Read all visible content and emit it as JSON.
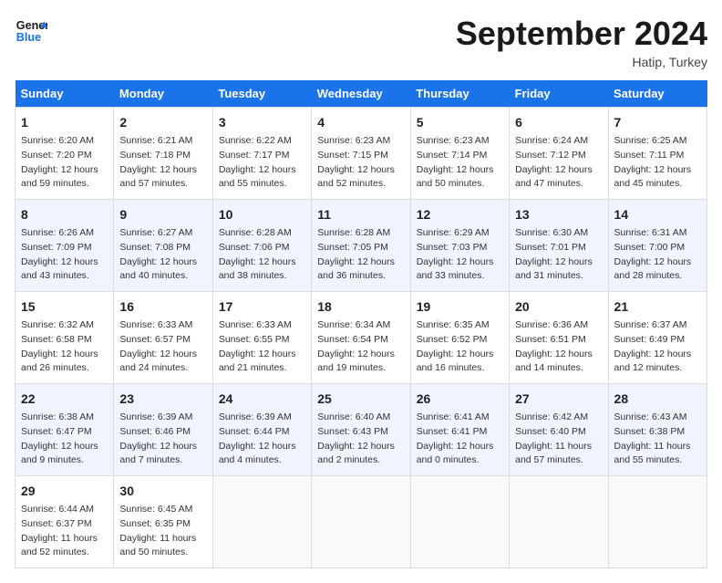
{
  "logo": {
    "line1": "General",
    "line2": "Blue"
  },
  "title": "September 2024",
  "location": "Hatip, Turkey",
  "days_of_week": [
    "Sunday",
    "Monday",
    "Tuesday",
    "Wednesday",
    "Thursday",
    "Friday",
    "Saturday"
  ],
  "weeks": [
    [
      {
        "day": "1",
        "sunrise": "6:20 AM",
        "sunset": "7:20 PM",
        "daylight": "12 hours and 59 minutes."
      },
      {
        "day": "2",
        "sunrise": "6:21 AM",
        "sunset": "7:18 PM",
        "daylight": "12 hours and 57 minutes."
      },
      {
        "day": "3",
        "sunrise": "6:22 AM",
        "sunset": "7:17 PM",
        "daylight": "12 hours and 55 minutes."
      },
      {
        "day": "4",
        "sunrise": "6:23 AM",
        "sunset": "7:15 PM",
        "daylight": "12 hours and 52 minutes."
      },
      {
        "day": "5",
        "sunrise": "6:23 AM",
        "sunset": "7:14 PM",
        "daylight": "12 hours and 50 minutes."
      },
      {
        "day": "6",
        "sunrise": "6:24 AM",
        "sunset": "7:12 PM",
        "daylight": "12 hours and 47 minutes."
      },
      {
        "day": "7",
        "sunrise": "6:25 AM",
        "sunset": "7:11 PM",
        "daylight": "12 hours and 45 minutes."
      }
    ],
    [
      {
        "day": "8",
        "sunrise": "6:26 AM",
        "sunset": "7:09 PM",
        "daylight": "12 hours and 43 minutes."
      },
      {
        "day": "9",
        "sunrise": "6:27 AM",
        "sunset": "7:08 PM",
        "daylight": "12 hours and 40 minutes."
      },
      {
        "day": "10",
        "sunrise": "6:28 AM",
        "sunset": "7:06 PM",
        "daylight": "12 hours and 38 minutes."
      },
      {
        "day": "11",
        "sunrise": "6:28 AM",
        "sunset": "7:05 PM",
        "daylight": "12 hours and 36 minutes."
      },
      {
        "day": "12",
        "sunrise": "6:29 AM",
        "sunset": "7:03 PM",
        "daylight": "12 hours and 33 minutes."
      },
      {
        "day": "13",
        "sunrise": "6:30 AM",
        "sunset": "7:01 PM",
        "daylight": "12 hours and 31 minutes."
      },
      {
        "day": "14",
        "sunrise": "6:31 AM",
        "sunset": "7:00 PM",
        "daylight": "12 hours and 28 minutes."
      }
    ],
    [
      {
        "day": "15",
        "sunrise": "6:32 AM",
        "sunset": "6:58 PM",
        "daylight": "12 hours and 26 minutes."
      },
      {
        "day": "16",
        "sunrise": "6:33 AM",
        "sunset": "6:57 PM",
        "daylight": "12 hours and 24 minutes."
      },
      {
        "day": "17",
        "sunrise": "6:33 AM",
        "sunset": "6:55 PM",
        "daylight": "12 hours and 21 minutes."
      },
      {
        "day": "18",
        "sunrise": "6:34 AM",
        "sunset": "6:54 PM",
        "daylight": "12 hours and 19 minutes."
      },
      {
        "day": "19",
        "sunrise": "6:35 AM",
        "sunset": "6:52 PM",
        "daylight": "12 hours and 16 minutes."
      },
      {
        "day": "20",
        "sunrise": "6:36 AM",
        "sunset": "6:51 PM",
        "daylight": "12 hours and 14 minutes."
      },
      {
        "day": "21",
        "sunrise": "6:37 AM",
        "sunset": "6:49 PM",
        "daylight": "12 hours and 12 minutes."
      }
    ],
    [
      {
        "day": "22",
        "sunrise": "6:38 AM",
        "sunset": "6:47 PM",
        "daylight": "12 hours and 9 minutes."
      },
      {
        "day": "23",
        "sunrise": "6:39 AM",
        "sunset": "6:46 PM",
        "daylight": "12 hours and 7 minutes."
      },
      {
        "day": "24",
        "sunrise": "6:39 AM",
        "sunset": "6:44 PM",
        "daylight": "12 hours and 4 minutes."
      },
      {
        "day": "25",
        "sunrise": "6:40 AM",
        "sunset": "6:43 PM",
        "daylight": "12 hours and 2 minutes."
      },
      {
        "day": "26",
        "sunrise": "6:41 AM",
        "sunset": "6:41 PM",
        "daylight": "12 hours and 0 minutes."
      },
      {
        "day": "27",
        "sunrise": "6:42 AM",
        "sunset": "6:40 PM",
        "daylight": "11 hours and 57 minutes."
      },
      {
        "day": "28",
        "sunrise": "6:43 AM",
        "sunset": "6:38 PM",
        "daylight": "11 hours and 55 minutes."
      }
    ],
    [
      {
        "day": "29",
        "sunrise": "6:44 AM",
        "sunset": "6:37 PM",
        "daylight": "11 hours and 52 minutes."
      },
      {
        "day": "30",
        "sunrise": "6:45 AM",
        "sunset": "6:35 PM",
        "daylight": "11 hours and 50 minutes."
      },
      null,
      null,
      null,
      null,
      null
    ]
  ]
}
